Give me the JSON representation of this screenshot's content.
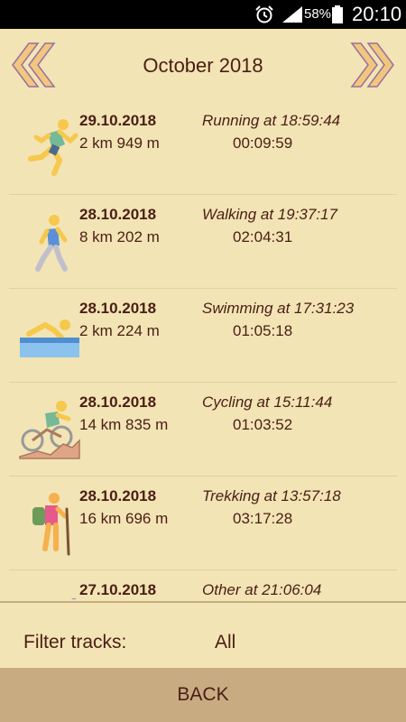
{
  "status_bar": {
    "battery_percent": "58%",
    "time": "20:10",
    "icons": [
      "alarm-icon",
      "signal-icon",
      "battery-icon"
    ]
  },
  "header": {
    "title": "October 2018",
    "prev_icon": "chevron-double-left-icon",
    "next_icon": "chevron-double-right-icon"
  },
  "tracks": [
    {
      "date": "29.10.2018",
      "distance": "2 km 949 m",
      "activity": "Running at 18:59:44",
      "duration": "00:09:59",
      "icon": "running-icon"
    },
    {
      "date": "28.10.2018",
      "distance": "8 km 202 m",
      "activity": "Walking at 19:37:17",
      "duration": "02:04:31",
      "icon": "walking-icon"
    },
    {
      "date": "28.10.2018",
      "distance": "2 km 224 m",
      "activity": "Swimming at 17:31:23",
      "duration": "01:05:18",
      "icon": "swimming-icon"
    },
    {
      "date": "28.10.2018",
      "distance": "14 km 835 m",
      "activity": "Cycling at 15:11:44",
      "duration": "01:03:52",
      "icon": "cycling-icon"
    },
    {
      "date": "28.10.2018",
      "distance": "16 km 696 m",
      "activity": "Trekking at 13:57:18",
      "duration": "03:17:28",
      "icon": "trekking-icon"
    },
    {
      "date": "27.10.2018",
      "distance": "",
      "activity": "Other at 21:06:04",
      "duration": "",
      "icon": "other-activity-icon"
    }
  ],
  "filter": {
    "label": "Filter tracks:",
    "value": "All"
  },
  "back_label": "BACK",
  "colors": {
    "background": "#f2e4b5",
    "text": "#4a1e14",
    "back_button": "#c9ab82",
    "nav_arrow_fill": "#f1c77d",
    "nav_arrow_stroke": "#9b6fa0"
  }
}
